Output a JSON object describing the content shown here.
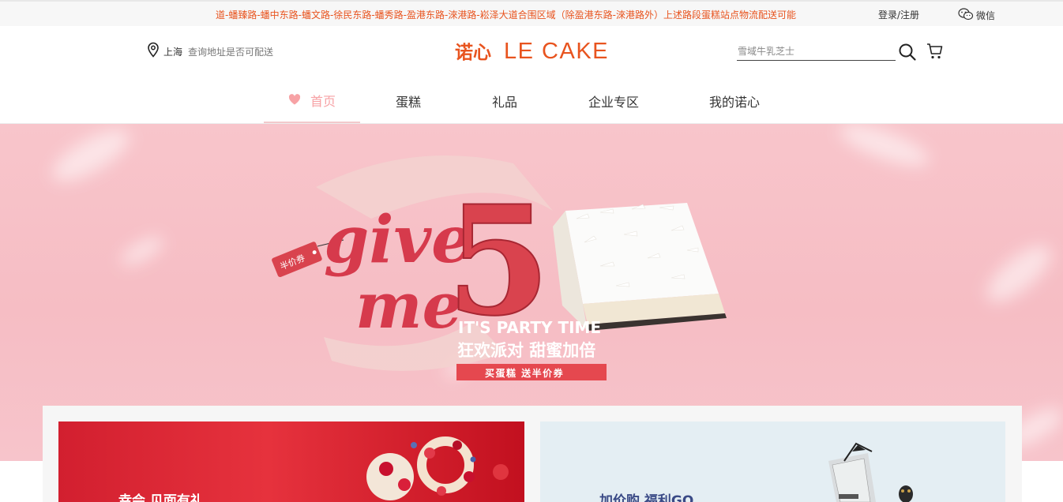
{
  "topbar": {
    "notice": "道-蟠臻路-蟠中东路-蟠文路-徐民东路-蟠秀路-盈港东路-淶港路-崧泽大道合围区域（除盈港东路-淶港路外）上述路段蛋糕站点物流配送可能",
    "login": "登录/注册",
    "wechat": "微信",
    "wechat_icon": "wechat-icon"
  },
  "header": {
    "city": "上海",
    "address_query": "查询地址是否可配送",
    "logo_cn": "诺心",
    "logo_en": "LE CAKE",
    "search_placeholder": "雪域牛乳芝士",
    "search_icon": "search-icon",
    "cart_icon": "cart-icon",
    "location_icon": "location-pin-icon"
  },
  "nav": {
    "items": [
      {
        "label": "首页",
        "active": true
      },
      {
        "label": "蛋糕"
      },
      {
        "label": "礼品"
      },
      {
        "label": "企业专区"
      },
      {
        "label": "我的诺心"
      }
    ]
  },
  "banner": {
    "tag": "半价券",
    "script_line1": "give",
    "script_line2": "me",
    "number": "5",
    "headline_en": "IT'S PARTY TIME",
    "headline_cn": "狂欢派对 甜蜜加倍",
    "button": "买蛋糕 送半价券"
  },
  "cards": [
    {
      "title": "幸会 见面有礼"
    },
    {
      "title": "加价购 福利GO"
    }
  ],
  "colors": {
    "brand": "#e8541f",
    "nav_active": "#f7a2a5",
    "banner_bg": "#f8c5cb",
    "banner_accent": "#e0434e"
  }
}
